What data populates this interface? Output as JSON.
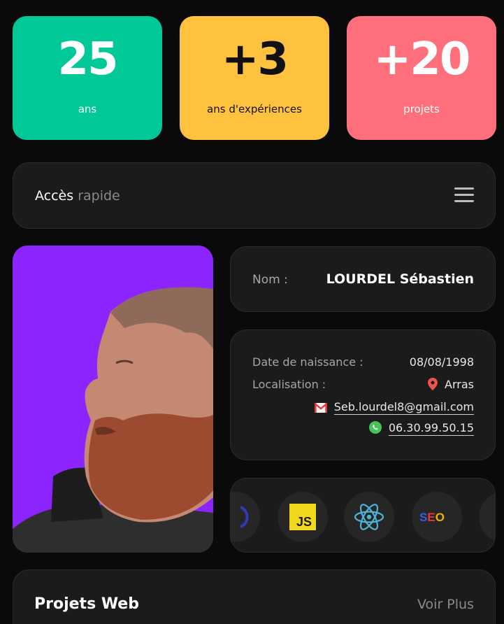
{
  "stats": [
    {
      "value": "25",
      "label": "ans",
      "color": "#00c896"
    },
    {
      "value": "+3",
      "label": "ans d'expériences",
      "color": "#ffc23e"
    },
    {
      "value": "+20",
      "label": "projets",
      "color": "#ff6f7b"
    }
  ],
  "quick_access": {
    "title_main": "Accès",
    "title_muted": "rapide",
    "menu_icon": "hamburger-menu-icon"
  },
  "profile": {
    "photo_background": "#8c24ff"
  },
  "identity": {
    "name_label": "Nom :",
    "name_value": "LOURDEL Sébastien"
  },
  "details": {
    "birth_label": "Date de naissance :",
    "birth_value": "08/08/1998",
    "location_label": "Localisation :",
    "location_value": "Arras",
    "email": "Seb.lourdel8@gmail.com",
    "phone": "06.30.99.50.15"
  },
  "skills": {
    "items": [
      {
        "name": "partial-skill-icon"
      },
      {
        "name": "javascript-icon",
        "text": "JS"
      },
      {
        "name": "react-icon"
      },
      {
        "name": "seo-icon",
        "text": "SEO"
      }
    ]
  },
  "projects": {
    "title": "Projets Web",
    "more_label": "Voir Plus"
  }
}
